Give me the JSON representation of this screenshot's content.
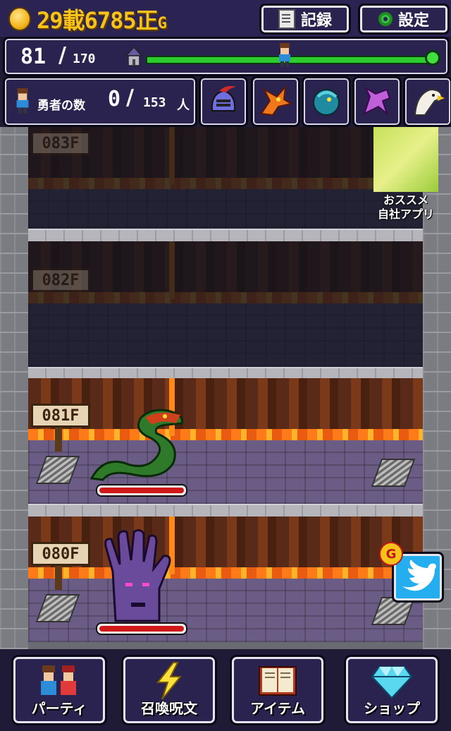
{
  "header": {
    "gold": "29載6785正",
    "gold_unit": "G",
    "record_label": "記録",
    "settings_label": "設定"
  },
  "progress": {
    "current": "81",
    "slash": "/",
    "max": "170",
    "fraction": 0.476
  },
  "heroes": {
    "label": "勇者の数",
    "count": "0",
    "slash": "/",
    "total": "153",
    "unit": "人"
  },
  "monster_icons": [
    "helmet-monster-icon",
    "orange-dragon-icon",
    "sea-serpent-icon",
    "purple-pegasus-icon",
    "eagle-icon"
  ],
  "floors": [
    {
      "label": "083F",
      "state": "dim"
    },
    {
      "label": "082F",
      "state": "dim"
    },
    {
      "label": "081F",
      "state": "active",
      "monster": "green-serpent-icon",
      "hp": 1.0
    },
    {
      "label": "080F",
      "state": "active",
      "monster": "purple-hand-monster-icon",
      "hp": 1.0
    }
  ],
  "ad": {
    "line1": "おススメ",
    "line2": "自社アプリ"
  },
  "twitter": {
    "badge": "G"
  },
  "nav": [
    {
      "label": "パーティ",
      "icon": "party-heroes-icon"
    },
    {
      "label": "召喚呪文",
      "icon": "lightning-icon"
    },
    {
      "label": "アイテム",
      "icon": "book-icon"
    },
    {
      "label": "ショップ",
      "icon": "diamond-icon"
    }
  ],
  "colors": {
    "gold": "#f7c21a",
    "panel": "#2a2350",
    "progress": "#2ecb2e",
    "lava": "#ff7b1a",
    "hp": "#d01818"
  }
}
